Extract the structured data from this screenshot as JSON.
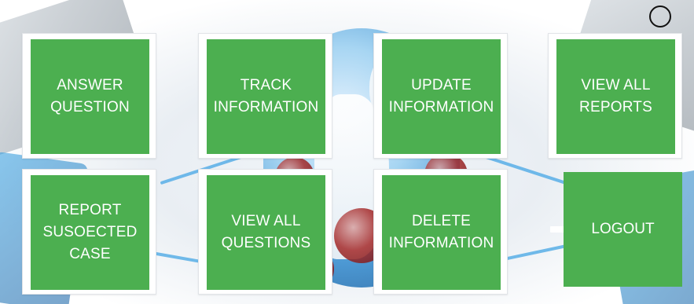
{
  "tiles": [
    {
      "label": "ANSWER\nQUESTION"
    },
    {
      "label": "TRACK\nINFORMATION"
    },
    {
      "label": "UPDATE\nINFORMATION"
    },
    {
      "label": "VIEW ALL\nREPORTS"
    },
    {
      "label": "REPORT\nSUSOECTED\nCASE"
    },
    {
      "label": "VIEW ALL\nQUESTIONS"
    },
    {
      "label": "DELETE\nINFORMATION"
    }
  ],
  "logout": {
    "label": "LOGOUT"
  },
  "colors": {
    "tile_green": "#4caf50",
    "tile_text": "#ffffff"
  },
  "icons": {
    "top_right": "circle-icon"
  }
}
